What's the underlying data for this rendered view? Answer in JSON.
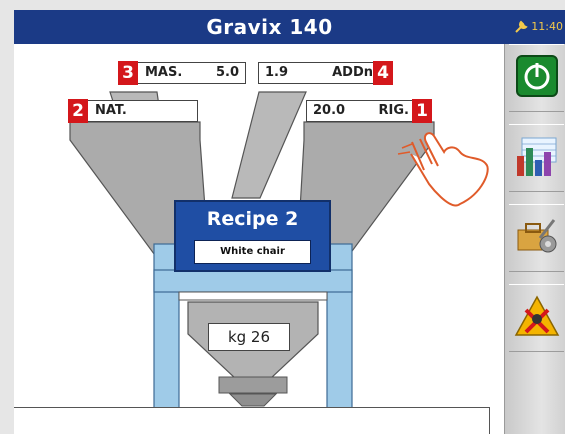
{
  "header": {
    "title": "Gravix 140",
    "time": "11:40"
  },
  "fields": {
    "f1": {
      "value": "20.0",
      "label": "RIG.",
      "badge": "1"
    },
    "f2": {
      "label": "NAT.",
      "badge": "2"
    },
    "f3": {
      "label": "MAS.",
      "value": "5.0",
      "badge": "3"
    },
    "f4": {
      "value": "1.9",
      "label": "ADDn",
      "badge": "4"
    }
  },
  "recipe": {
    "title": "Recipe 2",
    "name": "White chair"
  },
  "scale": {
    "reading": "kg 26"
  },
  "sidebar": {
    "icons": [
      "power-icon",
      "bar-chart-icon",
      "tools-settings-icon",
      "warning-icon"
    ]
  },
  "colors": {
    "titlebar": "#1b3a86",
    "accent_red": "#d4171b",
    "power_green": "#1a8a2e",
    "recipe_blue": "#1f4ea4",
    "hopper_gray": "#a9a9a9",
    "column_blue": "#9fcbe8"
  }
}
